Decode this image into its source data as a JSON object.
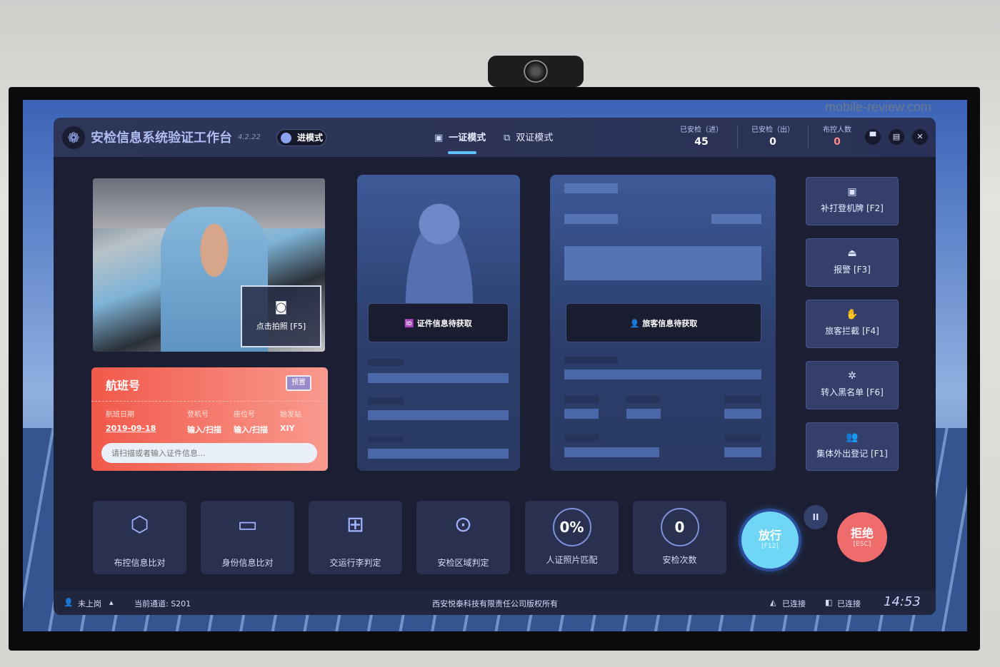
{
  "watermark": "mobile-review.com",
  "header": {
    "title": "安检信息系统验证工作台",
    "version": "4.2.22",
    "mode_toggle": "进模式",
    "tabs": [
      {
        "label": "一证模式",
        "icon": "id-card-icon",
        "active": true
      },
      {
        "label": "双证模式",
        "icon": "dual-card-icon",
        "active": false
      }
    ],
    "stats": [
      {
        "label": "已安检（进）",
        "value": "45"
      },
      {
        "label": "已安检（出）",
        "value": "0"
      },
      {
        "label": "布控人数",
        "value": "0",
        "color": "#ff8a8a"
      }
    ]
  },
  "camera": {
    "capture_label": "点击拍照 [F5]"
  },
  "flight": {
    "title": "航班号",
    "preset_label": "预置",
    "fields": [
      {
        "label": "航班日期",
        "value": "2019-09-18"
      },
      {
        "label": "登机号",
        "value": "输入/扫描"
      },
      {
        "label": "座位号",
        "value": "输入/扫描"
      },
      {
        "label": "始发站",
        "value": "XIY"
      }
    ],
    "input_placeholder": "请扫描或者输入证件信息..."
  },
  "id_card": {
    "status": "证件信息待获取"
  },
  "passenger": {
    "status": "旅客信息待获取"
  },
  "side_buttons": [
    {
      "label": "补打登机牌 [F2]",
      "icon": "print-icon"
    },
    {
      "label": "报警 [F3]",
      "icon": "alarm-icon"
    },
    {
      "label": "旅客拦截 [F4]",
      "icon": "hand-icon"
    },
    {
      "label": "转入黑名单 [F6]",
      "icon": "blacklist-icon"
    },
    {
      "label": "集体外出登记 [F1]",
      "icon": "group-icon"
    }
  ],
  "tiles": [
    {
      "label": "布控信息比对",
      "icon": "web-icon"
    },
    {
      "label": "身份信息比对",
      "icon": "id-icon"
    },
    {
      "label": "交运行李判定",
      "icon": "luggage-icon"
    },
    {
      "label": "安检区域判定",
      "icon": "location-icon"
    },
    {
      "label": "人证照片匹配",
      "value": "0%"
    },
    {
      "label": "安检次数",
      "value": "0"
    }
  ],
  "actions": {
    "pass": "放行",
    "pass_key": "[F12]",
    "reject": "拒绝",
    "reject_key": "[ESC]",
    "pause": "II"
  },
  "footer": {
    "user": "未上岗",
    "channel": "当前通道: S201",
    "copyright": "西安悦泰科技有限责任公司版权所有",
    "conn1": "已连接",
    "conn2": "已连接",
    "time": "14:53"
  },
  "colors": {
    "accent": "#5fc2ff",
    "danger": "#ef6c6c",
    "ticket": "#f1594a",
    "pass": "#6fd6f6"
  }
}
